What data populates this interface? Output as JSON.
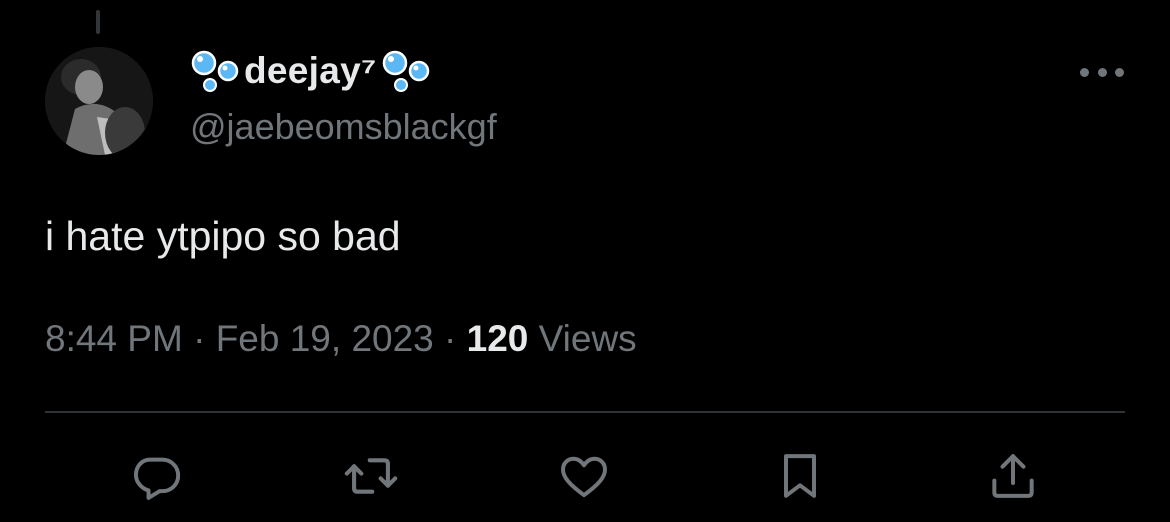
{
  "author": {
    "display_name": "deejay⁷",
    "handle": "@jaebeomsblackgf",
    "avatar_icon": "profile-photo"
  },
  "tweet": {
    "text": "i hate ytpipo so bad",
    "time": "8:44 PM",
    "date": "Feb 19, 2023",
    "views_count": "120",
    "views_label": "Views",
    "separator": "·"
  },
  "actions": {
    "reply_icon": "reply-icon",
    "retweet_icon": "retweet-icon",
    "like_icon": "heart-icon",
    "bookmark_icon": "bookmark-icon",
    "share_icon": "share-icon"
  },
  "colors": {
    "background": "#000000",
    "primary_text": "#e7e9ea",
    "secondary_text": "#71767b",
    "divider": "#2f3336",
    "bubble_emoji": "#5bb8f5"
  }
}
